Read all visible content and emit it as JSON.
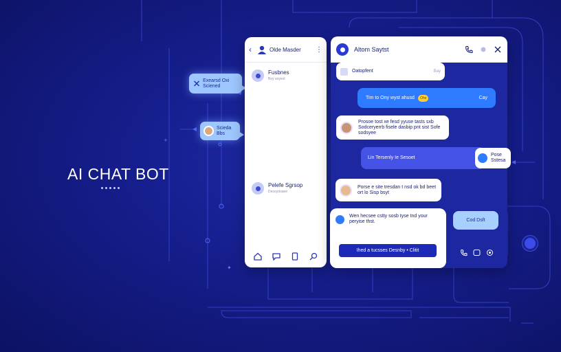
{
  "hero": {
    "title": "AI CHAT BOT"
  },
  "floating": {
    "bubble1": {
      "text": "Exearsd Oxi Sciened"
    },
    "bubble2": {
      "text": "Scieda Bbs"
    }
  },
  "left_panel": {
    "back_icon": "chevron-left-icon",
    "user_icon": "user-icon",
    "contact_name": "Olde Masder",
    "items": [
      {
        "title": "Fusbnes",
        "subtitle": "Boy soyeol"
      },
      {
        "title": "Pelefe Sgrsop",
        "subtitle": "Desoydoaee"
      }
    ],
    "footer_icons": [
      "home-icon",
      "chat-icon",
      "document-icon",
      "search-icon"
    ]
  },
  "right_panel": {
    "title": "Altom Saytst",
    "actions": [
      "phone-icon",
      "circle-icon",
      "close-icon"
    ],
    "messages": {
      "m1": {
        "text": "Oatopfent",
        "meta": "Bay"
      },
      "m2": {
        "text": "Tim to Ony wyst ahusd",
        "tag": "Ohe",
        "meta": "Cay"
      },
      "m3": {
        "text": "Prosoe tost xe fesd yyuse tasts sxb Sodceryerrb fisele dasbip pnt sist Sofe sodsyee"
      },
      "m4": {
        "text": "Lin Tersenly Ie Sesoet"
      },
      "m4b": {
        "text": "Pose Sstesa"
      },
      "m5": {
        "text": "Porse e site tresdan t nsd ok bd beet ort lo Sisp bsyt"
      },
      "m6": {
        "text": "Wen hecsee cstty sosb tyse tnd your peryise thst.",
        "cta": "Ihed a tucsses Desnby • Clitit"
      },
      "m7": {
        "text": "Cod Dsft"
      }
    },
    "footer_icons": [
      "phone-icon",
      "chat-icon",
      "settings-icon"
    ]
  },
  "colors": {
    "accent": "#2f7bff",
    "background": "#151d8a",
    "cta": "#1d2ab8"
  }
}
